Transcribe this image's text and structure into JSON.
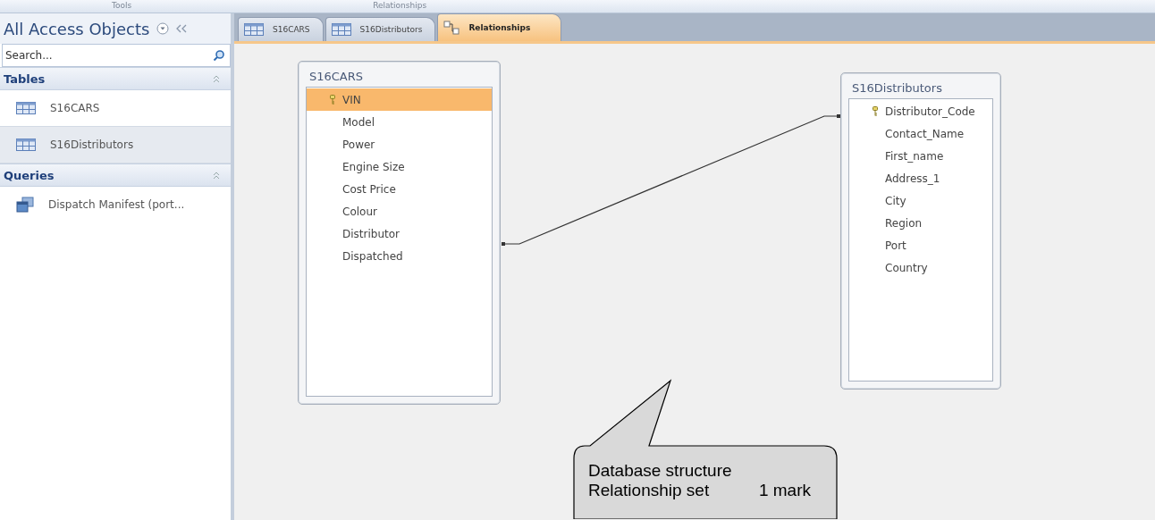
{
  "ribbon": {
    "groups": [
      "Tools",
      "Relationships"
    ]
  },
  "navigation_pane": {
    "title": "All Access Objects",
    "search": {
      "placeholder": "Search..."
    },
    "groups": [
      {
        "label": "Tables",
        "expanded": true,
        "items": [
          {
            "label": "S16CARS",
            "kind": "table",
            "selected": false
          },
          {
            "label": "S16Distributors",
            "kind": "table",
            "selected": true
          }
        ]
      },
      {
        "label": "Queries",
        "expanded": true,
        "items": [
          {
            "label": "Dispatch Manifest (port...",
            "kind": "query",
            "selected": false
          }
        ]
      }
    ]
  },
  "tabs": [
    {
      "label": "S16CARS",
      "kind": "table",
      "selected": false
    },
    {
      "label": "S16Distributors",
      "kind": "table",
      "selected": false
    },
    {
      "label": "Relationships",
      "kind": "relationships",
      "selected": true
    }
  ],
  "relationship_tables": [
    {
      "title": "S16CARS",
      "fields": [
        {
          "name": "VIN",
          "key": true,
          "selected": true
        },
        {
          "name": "Model",
          "key": false,
          "selected": false
        },
        {
          "name": "Power",
          "key": false,
          "selected": false
        },
        {
          "name": "Engine Size",
          "key": false,
          "selected": false
        },
        {
          "name": "Cost Price",
          "key": false,
          "selected": false
        },
        {
          "name": "Colour",
          "key": false,
          "selected": false
        },
        {
          "name": "Distributor",
          "key": false,
          "selected": false
        },
        {
          "name": "Dispatched",
          "key": false,
          "selected": false
        }
      ]
    },
    {
      "title": "S16Distributors",
      "fields": [
        {
          "name": "Distributor_Code",
          "key": true,
          "selected": false
        },
        {
          "name": "Contact_Name",
          "key": false,
          "selected": false
        },
        {
          "name": "First_name",
          "key": false,
          "selected": false
        },
        {
          "name": "Address_1",
          "key": false,
          "selected": false
        },
        {
          "name": "City",
          "key": false,
          "selected": false
        },
        {
          "name": "Region",
          "key": false,
          "selected": false
        },
        {
          "name": "Port",
          "key": false,
          "selected": false
        },
        {
          "name": "Country",
          "key": false,
          "selected": false
        }
      ]
    }
  ],
  "callout": {
    "lines": [
      "Database structure",
      "Relationship set"
    ],
    "mark": "1 mark"
  }
}
